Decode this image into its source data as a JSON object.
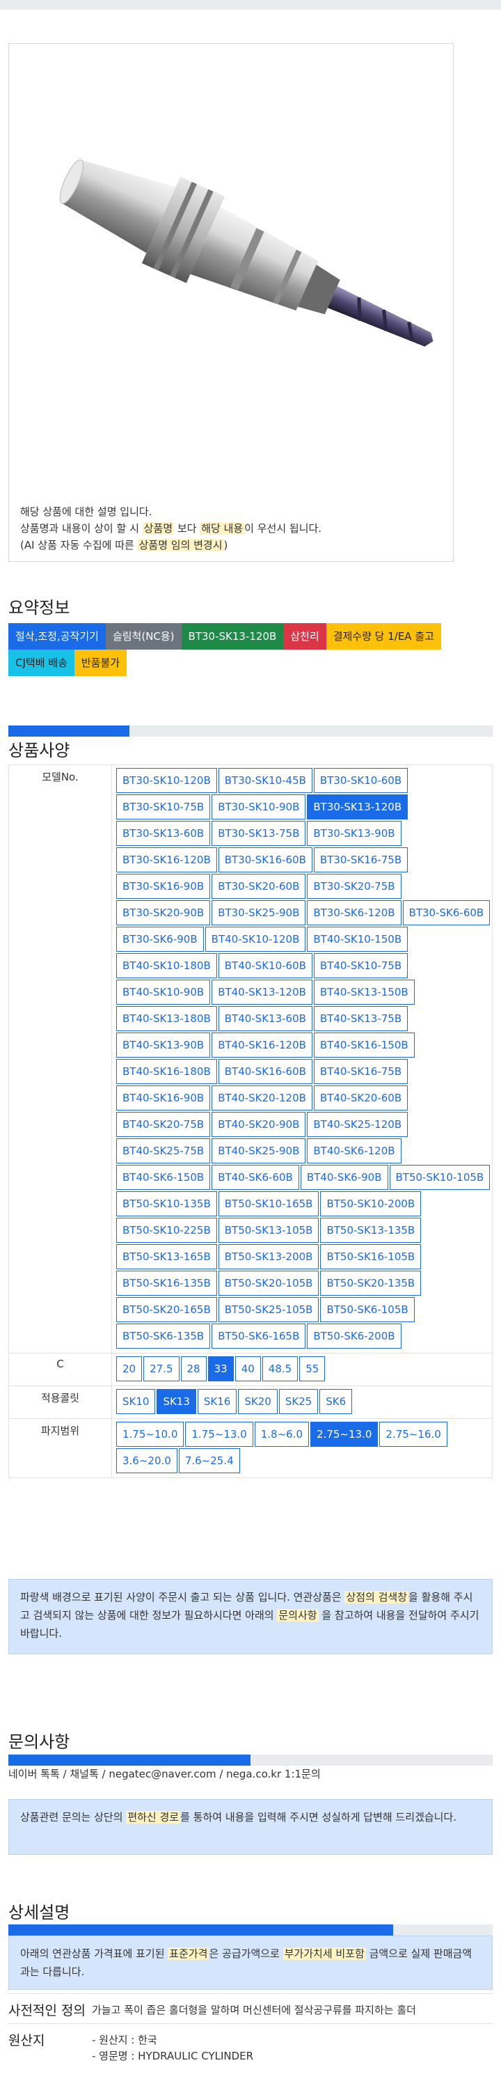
{
  "product_image": {
    "note_line1": "해당 상품에 대한 설명 입니다.",
    "note_line2_pre": "상품명과 내용이 상이 할 시 ",
    "note_line2_hl1": "상품명",
    "note_line2_mid": " 보다 ",
    "note_line2_hl2": "해당 내용",
    "note_line2_post": "이 우선시 됩니다.",
    "note_line3_pre": "(AI 상품 자동 수집에 따른 ",
    "note_line3_hl": "상품명 임의 변경시",
    "note_line3_post": ")"
  },
  "summary": {
    "title": "요약정보",
    "tags": [
      {
        "label": "절삭,조정,공작기기",
        "color": "#1a6be8",
        "text_color": "#ffffff"
      },
      {
        "label": "슬림척(NC용)",
        "color": "#6c757d",
        "text_color": "#ffffff"
      },
      {
        "label": "BT30-SK13-120B",
        "color": "#1e8a47",
        "text_color": "#ffffff"
      },
      {
        "label": "삼천리",
        "color": "#dc3545",
        "text_color": "#ffffff"
      },
      {
        "label": "결제수량 당 1/EA 출고",
        "color": "#ffc107",
        "text_color": "#222222"
      },
      {
        "label": "CJ택배 배송",
        "color": "#17c1e8",
        "text_color": "#222222"
      },
      {
        "label": "반품불가",
        "color": "#ffc107",
        "text_color": "#222222"
      }
    ]
  },
  "specs": {
    "title": "상품사양",
    "progress": 0.25,
    "rows": [
      {
        "label": "모델No.",
        "selected": "BT30-SK13-120B",
        "options": [
          "BT30-SK10-120B",
          "BT30-SK10-45B",
          "BT30-SK10-60B",
          "BT30-SK10-75B",
          "BT30-SK10-90B",
          "BT30-SK13-120B",
          "BT30-SK13-60B",
          "BT30-SK13-75B",
          "BT30-SK13-90B",
          "BT30-SK16-120B",
          "BT30-SK16-60B",
          "BT30-SK16-75B",
          "BT30-SK16-90B",
          "BT30-SK20-60B",
          "BT30-SK20-75B",
          "BT30-SK20-90B",
          "BT30-SK25-90B",
          "BT30-SK6-120B",
          "BT30-SK6-60B",
          "BT30-SK6-90B",
          "BT40-SK10-120B",
          "BT40-SK10-150B",
          "BT40-SK10-180B",
          "BT40-SK10-60B",
          "BT40-SK10-75B",
          "BT40-SK10-90B",
          "BT40-SK13-120B",
          "BT40-SK13-150B",
          "BT40-SK13-180B",
          "BT40-SK13-60B",
          "BT40-SK13-75B",
          "BT40-SK13-90B",
          "BT40-SK16-120B",
          "BT40-SK16-150B",
          "BT40-SK16-180B",
          "BT40-SK16-60B",
          "BT40-SK16-75B",
          "BT40-SK16-90B",
          "BT40-SK20-120B",
          "BT40-SK20-60B",
          "BT40-SK20-75B",
          "BT40-SK20-90B",
          "BT40-SK25-120B",
          "BT40-SK25-75B",
          "BT40-SK25-90B",
          "BT40-SK6-120B",
          "BT40-SK6-150B",
          "BT40-SK6-60B",
          "BT40-SK6-90B",
          "BT50-SK10-105B",
          "BT50-SK10-135B",
          "BT50-SK10-165B",
          "BT50-SK10-200B",
          "BT50-SK10-225B",
          "BT50-SK13-105B",
          "BT50-SK13-135B",
          "BT50-SK13-165B",
          "BT50-SK13-200B",
          "BT50-SK16-105B",
          "BT50-SK16-135B",
          "BT50-SK20-105B",
          "BT50-SK20-135B",
          "BT50-SK20-165B",
          "BT50-SK25-105B",
          "BT50-SK6-105B",
          "BT50-SK6-135B",
          "BT50-SK6-165B",
          "BT50-SK6-200B"
        ]
      },
      {
        "label": "C",
        "selected": "33",
        "options": [
          "20",
          "27.5",
          "28",
          "33",
          "40",
          "48.5",
          "55"
        ]
      },
      {
        "label": "적용콜릿",
        "selected": "SK13",
        "options": [
          "SK10",
          "SK13",
          "SK16",
          "SK20",
          "SK25",
          "SK6"
        ]
      },
      {
        "label": "파지범위",
        "selected": "2.75~13.0",
        "options": [
          "1.75~10.0",
          "1.75~13.0",
          "1.8~6.0",
          "2.75~13.0",
          "2.75~16.0",
          "3.6~20.0",
          "7.6~25.4"
        ]
      }
    ],
    "notice_pre": "파랑색 배경으로 표기된 사양이 주문시 출고 되는 상품 입니다. 연관상품은 ",
    "notice_hl1": "상점의 검색창",
    "notice_mid": "을 활용해 주시고 검색되지 않는 상품에 대한 정보가 필요하시다면 아래의 ",
    "notice_hl2": "문의사항",
    "notice_post": " 을 참고하여 내용을 전달하여 주시기 바랍니다."
  },
  "inquiry": {
    "title": "문의사항",
    "progress": 0.5,
    "contact": "네이버 톡톡  /  채널톡  /  negatec@naver.com  /  nega.co.kr 1:1문의",
    "notice_pre": "상품관련 문의는 상단의 ",
    "notice_hl": "편하신 경로",
    "notice_post": "를 통하여 내용을 입력해 주시면 성실하게 답변해 드리겠습니다."
  },
  "detail": {
    "title": "상세설명",
    "progress": 0.795,
    "notice_pre": "아래의 연관상품 가격표에 표기된 ",
    "notice_hl1": "표준가격",
    "notice_mid": "은 공급가액으로 ",
    "notice_hl2": "부가가치세 비포함",
    "notice_post": " 금액으로 실제 판매금액과는 다릅니다.",
    "rows": [
      {
        "label": "사전적인 정의",
        "value": "가늘고 폭이 좁은 홀더형을 말하며 머신센터에 절삭공구류를 파지하는 홀더"
      },
      {
        "label": "원산지",
        "values": [
          "- 원산지 : 한국",
          "- 영문명 : HYDRAULIC CYLINDER"
        ]
      }
    ]
  }
}
